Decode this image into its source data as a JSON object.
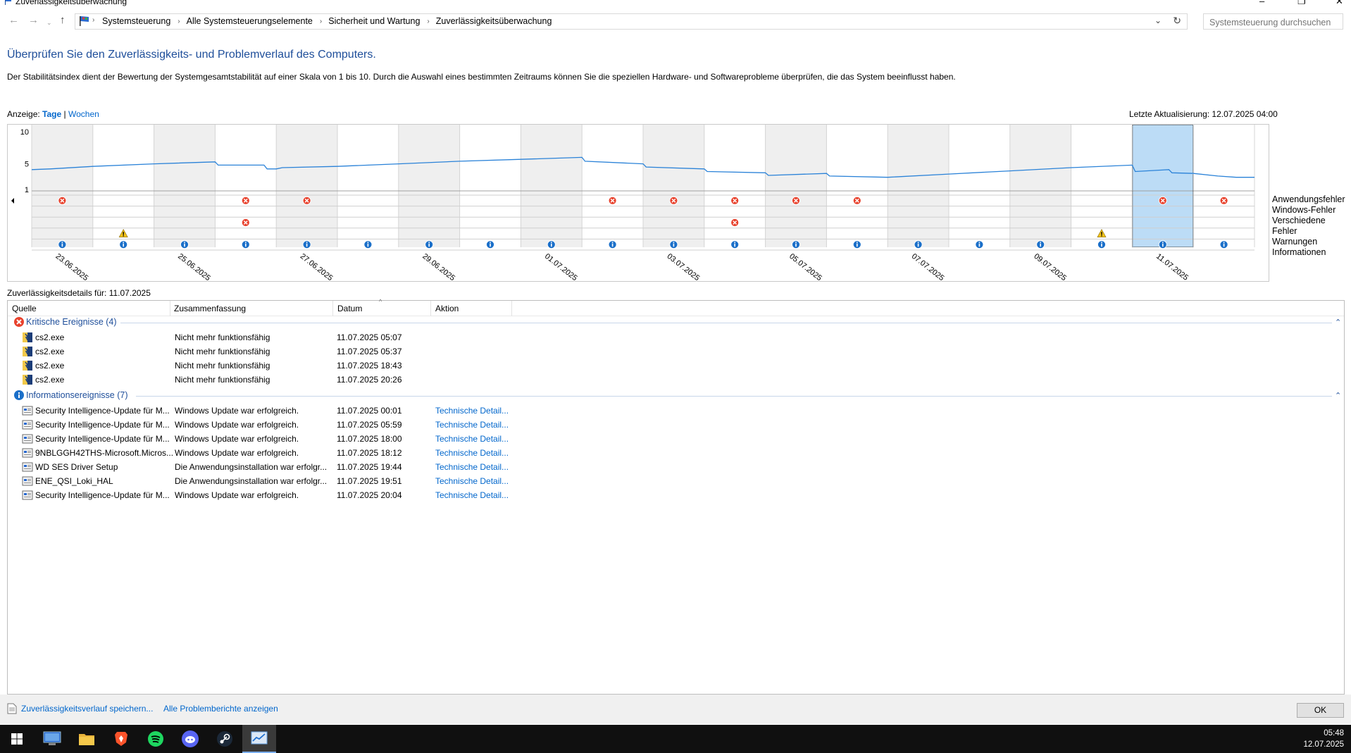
{
  "window": {
    "title": "Zuverlässigkeitsüberwachung"
  },
  "addressbar": {
    "crumbs": [
      "Systemsteuerung",
      "Alle Systemsteuerungselemente",
      "Sicherheit und Wartung",
      "Zuverlässigkeitsüberwachung"
    ]
  },
  "search": {
    "placeholder": "Systemsteuerung durchsuchen"
  },
  "page": {
    "heading": "Überprüfen Sie den Zuverlässigkeits- und Problemverlauf des Computers.",
    "description": "Der Stabilitätsindex dient der Bewertung der Systemgesamtstabilität auf einer Skala von 1 bis 10. Durch die Auswahl eines bestimmten Zeitraums können Sie die speziellen Hardware- und Softwareprobleme überprüfen, die das System beeinflusst haben.",
    "view_label": "Anzeige:",
    "view_days": "Tage",
    "view_sep": "|",
    "view_weeks": "Wochen",
    "last_update": "Letzte Aktualisierung: 12.07.2025 04:00"
  },
  "chart_data": {
    "type": "line",
    "y_ticks": [
      10,
      5,
      1
    ],
    "ylim": [
      1,
      10
    ],
    "dates": [
      "23.06.2025",
      "24.06.2025",
      "25.06.2025",
      "26.06.2025",
      "27.06.2025",
      "28.06.2025",
      "29.06.2025",
      "30.06.2025",
      "01.07.2025",
      "02.07.2025",
      "03.07.2025",
      "04.07.2025",
      "05.07.2025",
      "06.07.2025",
      "07.07.2025",
      "08.07.2025",
      "09.07.2025",
      "10.07.2025",
      "11.07.2025",
      "12.07.2025"
    ],
    "x_labels": [
      "23.06.2025",
      "25.06.2025",
      "27.06.2025",
      "29.06.2025",
      "01.07.2025",
      "03.07.2025",
      "05.07.2025",
      "07.07.2025",
      "09.07.2025",
      "11.07.2025"
    ],
    "selected": "11.07.2025",
    "stability": [
      [
        0,
        4.1
      ],
      [
        0.3,
        4.2
      ],
      [
        1,
        4.6
      ],
      [
        2,
        5.0
      ],
      [
        3,
        5.3
      ],
      [
        3.05,
        4.8
      ],
      [
        3.8,
        4.8
      ],
      [
        3.85,
        4.2
      ],
      [
        4,
        4.2
      ],
      [
        4.1,
        4.4
      ],
      [
        5,
        4.6
      ],
      [
        6,
        5.0
      ],
      [
        7,
        5.4
      ],
      [
        8,
        5.7
      ],
      [
        9,
        6.0
      ],
      [
        9.05,
        5.4
      ],
      [
        10,
        5.0
      ],
      [
        10.05,
        4.5
      ],
      [
        11,
        4.2
      ],
      [
        11.05,
        3.8
      ],
      [
        12,
        3.6
      ],
      [
        12.05,
        3.2
      ],
      [
        13,
        3.5
      ],
      [
        13.05,
        3.1
      ],
      [
        14,
        2.9
      ],
      [
        15,
        3.4
      ],
      [
        16,
        3.9
      ],
      [
        17,
        4.4
      ],
      [
        18,
        4.8
      ],
      [
        18.05,
        3.8
      ],
      [
        18.6,
        4.1
      ],
      [
        18.65,
        3.6
      ],
      [
        19,
        3.5
      ],
      [
        19.4,
        3.1
      ],
      [
        19.7,
        2.9
      ],
      [
        20,
        2.9
      ]
    ],
    "rows": [
      "Anwendungsfehler",
      "Windows-Fehler",
      "Verschiedene Fehler",
      "Warnungen",
      "Informationen"
    ],
    "events": {
      "app_errors": [
        0,
        3,
        4,
        9,
        10,
        11,
        12,
        13,
        18,
        19
      ],
      "windows_errors": [],
      "misc_errors": [
        3,
        11
      ],
      "warnings": [
        1,
        17
      ],
      "information": [
        0,
        1,
        2,
        3,
        4,
        5,
        6,
        7,
        8,
        9,
        10,
        11,
        12,
        13,
        14,
        15,
        16,
        17,
        18,
        19
      ]
    }
  },
  "details": {
    "label": "Zuverlässigkeitsdetails für: 11.07.2025",
    "columns": [
      "Quelle",
      "Zusammenfassung",
      "Datum",
      "Aktion"
    ],
    "critical_title": "Kritische Ereignisse (4)",
    "critical": [
      {
        "source": "cs2.exe",
        "summary": "Nicht mehr funktionsfähig",
        "date": "11.07.2025 05:07"
      },
      {
        "source": "cs2.exe",
        "summary": "Nicht mehr funktionsfähig",
        "date": "11.07.2025 05:37"
      },
      {
        "source": "cs2.exe",
        "summary": "Nicht mehr funktionsfähig",
        "date": "11.07.2025 18:43"
      },
      {
        "source": "cs2.exe",
        "summary": "Nicht mehr funktionsfähig",
        "date": "11.07.2025 20:26"
      }
    ],
    "info_title": "Informationsereignisse (7)",
    "info": [
      {
        "source": "Security Intelligence-Update für M...",
        "summary": "Windows Update war erfolgreich.",
        "date": "11.07.2025 00:01",
        "action": "Technische Detail..."
      },
      {
        "source": "Security Intelligence-Update für M...",
        "summary": "Windows Update war erfolgreich.",
        "date": "11.07.2025 05:59",
        "action": "Technische Detail..."
      },
      {
        "source": "Security Intelligence-Update für M...",
        "summary": "Windows Update war erfolgreich.",
        "date": "11.07.2025 18:00",
        "action": "Technische Detail..."
      },
      {
        "source": "9NBLGGH42THS-Microsoft.Micros...",
        "summary": "Windows Update war erfolgreich.",
        "date": "11.07.2025 18:12",
        "action": "Technische Detail..."
      },
      {
        "source": "WD SES Driver Setup",
        "summary": "Die Anwendungsinstallation war erfolgr...",
        "date": "11.07.2025 19:44",
        "action": "Technische Detail..."
      },
      {
        "source": "ENE_QSI_Loki_HAL",
        "summary": "Die Anwendungsinstallation war erfolgr...",
        "date": "11.07.2025 19:51",
        "action": "Technische Detail..."
      },
      {
        "source": "Security Intelligence-Update für M...",
        "summary": "Windows Update war erfolgreich.",
        "date": "11.07.2025 20:04",
        "action": "Technische Detail..."
      }
    ]
  },
  "footer": {
    "save_link": "Zuverlässigkeitsverlauf speichern...",
    "reports_link": "Alle Problemberichte anzeigen",
    "ok": "OK"
  },
  "taskbar": {
    "icons": [
      "windows-start-icon",
      "control-panel-icon",
      "file-explorer-icon",
      "brave-browser-icon",
      "spotify-icon",
      "discord-icon",
      "steam-icon",
      "reliability-monitor-icon"
    ],
    "time": "05:48",
    "date": "12.07.2025"
  }
}
